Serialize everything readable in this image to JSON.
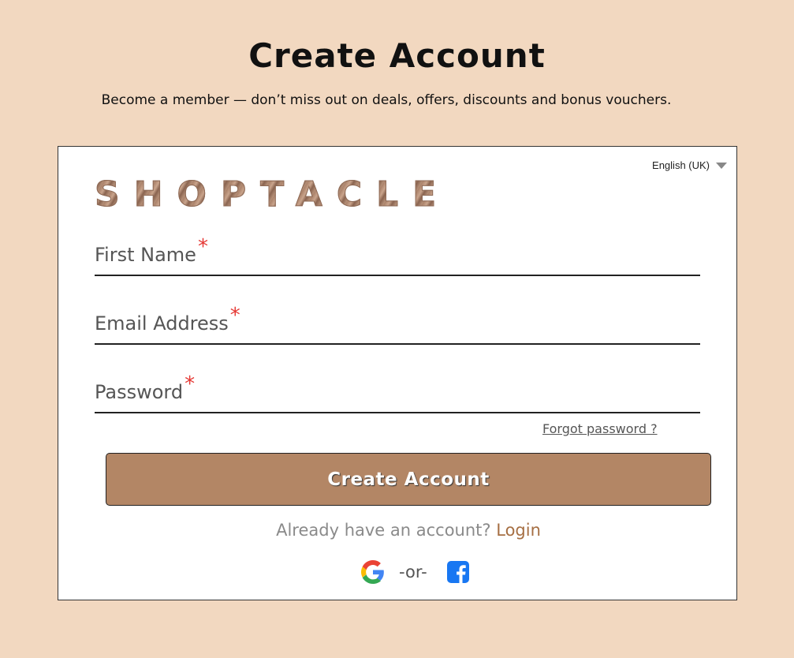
{
  "header": {
    "title": "Create Account",
    "subtitle": "Become a member — don’t miss out on deals, offers, discounts and bonus vouchers."
  },
  "language": {
    "selected": "English (UK)"
  },
  "brand": {
    "logo_text": "SHOPTACLE"
  },
  "form": {
    "fields": [
      {
        "label": "First Name",
        "required_mark": "*",
        "value": ""
      },
      {
        "label": "Email Address",
        "required_mark": "*",
        "value": ""
      },
      {
        "label": "Password",
        "required_mark": "*",
        "value": ""
      }
    ],
    "forgot_label": "Forgot password ?",
    "submit_label": "Create Account"
  },
  "footer": {
    "already_text": "Already have an account?",
    "login_label": "Login",
    "or_text": "-or-",
    "social_icons": [
      "google-icon",
      "facebook-icon"
    ]
  },
  "colors": {
    "background": "#f2d8c0",
    "button": "#b38665",
    "link_accent": "#a66f43",
    "required": "#e53935",
    "facebook": "#1877f2"
  }
}
